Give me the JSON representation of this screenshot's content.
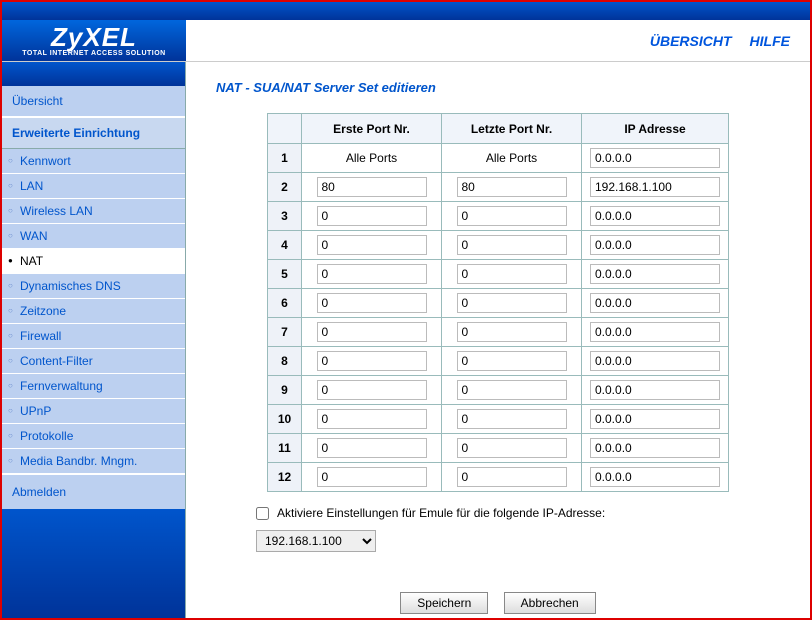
{
  "brand": {
    "name": "ZyXEL",
    "tagline": "TOTAL INTERNET ACCESS SOLUTION"
  },
  "topnav": {
    "overview": "ÜBERSICHT",
    "help": "HILFE"
  },
  "sidebar": {
    "overview": "Übersicht",
    "group": "Erweiterte Einrichtung",
    "items": [
      {
        "label": "Kennwort"
      },
      {
        "label": "LAN"
      },
      {
        "label": "Wireless LAN"
      },
      {
        "label": "WAN"
      },
      {
        "label": "NAT",
        "active": true
      },
      {
        "label": "Dynamisches DNS"
      },
      {
        "label": "Zeitzone"
      },
      {
        "label": "Firewall"
      },
      {
        "label": "Content-Filter"
      },
      {
        "label": "Fernverwaltung"
      },
      {
        "label": "UPnP"
      },
      {
        "label": "Protokolle"
      },
      {
        "label": "Media Bandbr. Mngm."
      }
    ],
    "logout": "Abmelden"
  },
  "page": {
    "title": "NAT - SUA/NAT Server Set editieren",
    "headers": {
      "first": "Erste Port Nr.",
      "last": "Letzte Port Nr.",
      "ip": "IP Adresse"
    },
    "rows": [
      {
        "n": "1",
        "first": "Alle Ports",
        "last": "Alle Ports",
        "ip": "0.0.0.0",
        "static": true
      },
      {
        "n": "2",
        "first": "80",
        "last": "80",
        "ip": "192.168.1.100"
      },
      {
        "n": "3",
        "first": "0",
        "last": "0",
        "ip": "0.0.0.0"
      },
      {
        "n": "4",
        "first": "0",
        "last": "0",
        "ip": "0.0.0.0"
      },
      {
        "n": "5",
        "first": "0",
        "last": "0",
        "ip": "0.0.0.0"
      },
      {
        "n": "6",
        "first": "0",
        "last": "0",
        "ip": "0.0.0.0"
      },
      {
        "n": "7",
        "first": "0",
        "last": "0",
        "ip": "0.0.0.0"
      },
      {
        "n": "8",
        "first": "0",
        "last": "0",
        "ip": "0.0.0.0"
      },
      {
        "n": "9",
        "first": "0",
        "last": "0",
        "ip": "0.0.0.0"
      },
      {
        "n": "10",
        "first": "0",
        "last": "0",
        "ip": "0.0.0.0"
      },
      {
        "n": "11",
        "first": "0",
        "last": "0",
        "ip": "0.0.0.0"
      },
      {
        "n": "12",
        "first": "0",
        "last": "0",
        "ip": "0.0.0.0"
      }
    ],
    "emule": {
      "label": "Aktiviere Einstellungen für Emule für die folgende IP-Adresse:",
      "selected": "192.168.1.100"
    },
    "buttons": {
      "save": "Speichern",
      "cancel": "Abbrechen"
    }
  }
}
